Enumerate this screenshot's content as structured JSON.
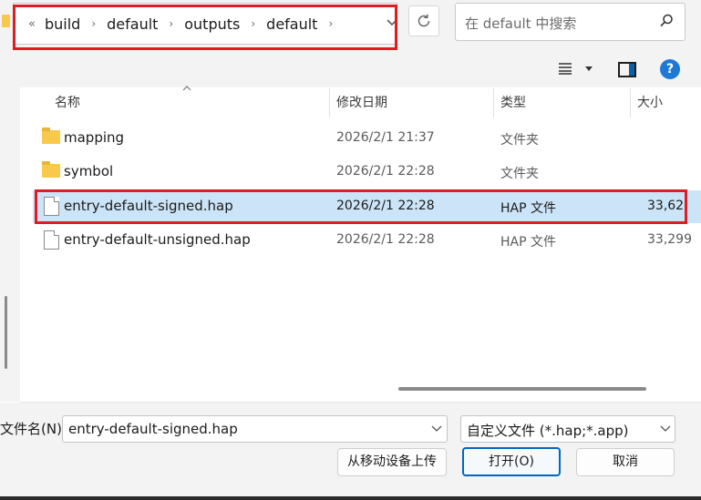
{
  "address_bar": {
    "back_glyph": "«",
    "breadcrumbs": [
      "build",
      "default",
      "outputs",
      "default"
    ],
    "separator": "›",
    "dropdown_icon": "chevron-down-icon",
    "refresh_icon": "refresh-icon"
  },
  "search": {
    "placeholder": "在 default 中搜索",
    "icon": "search-icon"
  },
  "toolbar": {
    "view_icon": "view-menu-icon",
    "preview_icon": "preview-pane-icon",
    "help_label": "?"
  },
  "columns": {
    "name": "名称",
    "date": "修改日期",
    "type": "类型",
    "size": "大小"
  },
  "files": [
    {
      "name": "mapping",
      "date": "2026/2/1 21:37",
      "type": "文件夹",
      "size": "",
      "icon": "folder-icon",
      "selected": false
    },
    {
      "name": "symbol",
      "date": "2026/2/1 22:28",
      "type": "文件夹",
      "size": "",
      "icon": "folder-icon",
      "selected": false
    },
    {
      "name": "entry-default-signed.hap",
      "date": "2026/2/1 22:28",
      "type": "HAP 文件",
      "size": "33,62",
      "icon": "file-icon",
      "selected": true
    },
    {
      "name": "entry-default-unsigned.hap",
      "date": "2026/2/1 22:28",
      "type": "HAP 文件",
      "size": "33,299",
      "icon": "file-icon",
      "selected": false
    }
  ],
  "bottom": {
    "filename_label": "文件名(N):",
    "filename_value": "entry-default-signed.hap",
    "filetype_value": "自定义文件 (*.hap;*.app)",
    "upload_button": "从移动设备上传",
    "open_button": "打开(O)",
    "cancel_button": "取消"
  },
  "colors": {
    "highlight_box": "#e11b22",
    "selection": "#cce4f7",
    "accent": "#0067c0"
  }
}
